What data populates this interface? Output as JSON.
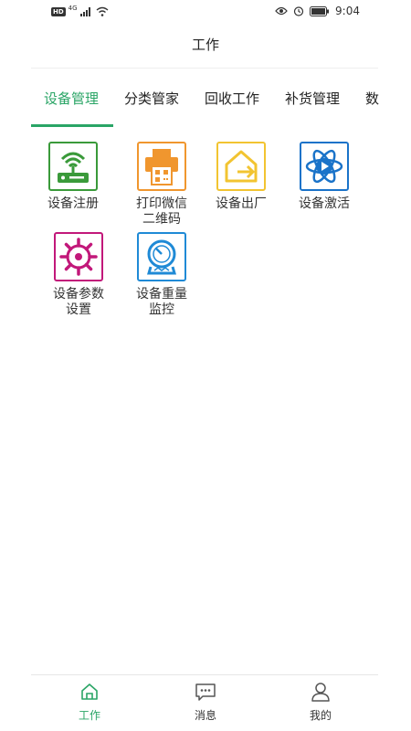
{
  "status_bar": {
    "hd_badge": "HD",
    "network": "4G",
    "time": "9:04"
  },
  "nav": {
    "title": "工作"
  },
  "tabs": [
    {
      "label": "设备管理",
      "active": true
    },
    {
      "label": "分类管家",
      "active": false
    },
    {
      "label": "回收工作",
      "active": false
    },
    {
      "label": "补货管理",
      "active": false
    },
    {
      "label": "数",
      "active": false
    }
  ],
  "grid": [
    {
      "label": "设备注册",
      "icon": "router-icon",
      "color": "#3a9a3a"
    },
    {
      "label": "打印微信\n二维码",
      "icon": "printer-icon",
      "color": "#f0962e"
    },
    {
      "label": "设备出厂",
      "icon": "house-exit-icon",
      "color": "#f2c431"
    },
    {
      "label": "设备激活",
      "icon": "atom-play-icon",
      "color": "#1a73c9"
    },
    {
      "label": "设备参数\n设置",
      "icon": "gear-icon",
      "color": "#c2187a"
    },
    {
      "label": "设备重量\n监控",
      "icon": "scale-icon",
      "color": "#1f8ad6"
    }
  ],
  "bottom_nav": [
    {
      "label": "工作",
      "icon": "home-icon",
      "active": true
    },
    {
      "label": "消息",
      "icon": "message-icon",
      "active": false
    },
    {
      "label": "我的",
      "icon": "user-icon",
      "active": false
    }
  ],
  "colors": {
    "accent": "#2aa566"
  }
}
